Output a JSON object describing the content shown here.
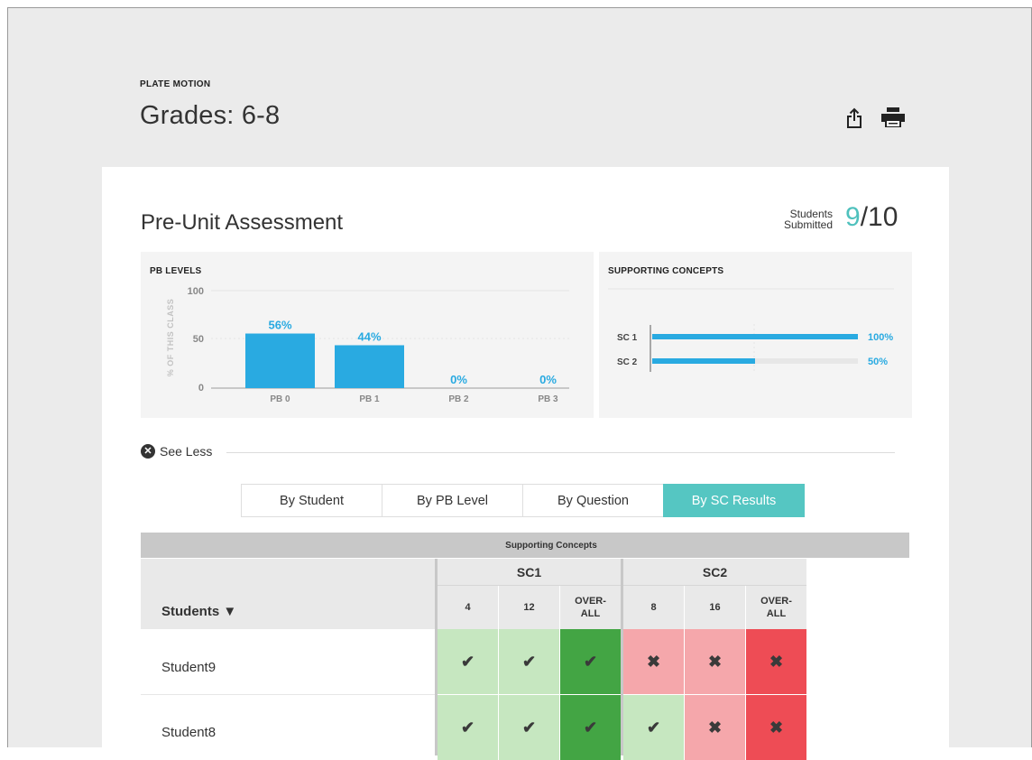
{
  "header": {
    "eyebrow": "PLATE MOTION",
    "title": "Grades: 6-8"
  },
  "icons": {
    "share": "share-icon",
    "print": "print-icon"
  },
  "assessment": {
    "title": "Pre-Unit Assessment",
    "submitted_label_line1": "Students",
    "submitted_label_line2": "Submitted",
    "submitted_value": "9",
    "submitted_total": "/10"
  },
  "pb_levels": {
    "title": "PB LEVELS",
    "ylabel": "% OF THIS CLASS",
    "yticks": [
      "100",
      "50",
      "0"
    ]
  },
  "supporting": {
    "title": "SUPPORTING CONCEPTS"
  },
  "chart_data": [
    {
      "type": "bar",
      "title": "PB LEVELS",
      "xlabel": "",
      "ylabel": "% OF THIS CLASS",
      "categories": [
        "PB 0",
        "PB 1",
        "PB 2",
        "PB 3"
      ],
      "values": [
        56,
        44,
        0,
        0
      ],
      "value_labels": [
        "56%",
        "44%",
        "0%",
        "0%"
      ],
      "ylim": [
        0,
        100
      ],
      "color": "#29aae1"
    },
    {
      "type": "bar",
      "orientation": "horizontal",
      "title": "SUPPORTING CONCEPTS",
      "categories": [
        "SC 1",
        "SC 2"
      ],
      "values": [
        100,
        50
      ],
      "value_labels": [
        "100%",
        "50%"
      ],
      "xlim": [
        0,
        100
      ],
      "color": "#29aae1"
    }
  ],
  "see_less": "See Less",
  "tabs": [
    {
      "label": "By Student",
      "active": false
    },
    {
      "label": "By PB Level",
      "active": false
    },
    {
      "label": "By Question",
      "active": false
    },
    {
      "label": "By SC Results",
      "active": true
    }
  ],
  "table": {
    "group_header": "Supporting Concepts",
    "students_header": "Students ▼",
    "groups": [
      {
        "label": "SC1",
        "columns": [
          "4",
          "12",
          "OVER-\nALL"
        ]
      },
      {
        "label": "SC2",
        "columns": [
          "8",
          "16",
          "OVER-\nALL"
        ]
      }
    ],
    "rows": [
      {
        "name": "Student9",
        "sc1": [
          "pass",
          "pass",
          "pass"
        ],
        "sc2": [
          "fail",
          "fail",
          "fail"
        ]
      },
      {
        "name": "Student8",
        "sc1": [
          "pass",
          "pass",
          "pass"
        ],
        "sc2": [
          "pass",
          "fail",
          "fail"
        ]
      }
    ],
    "symbols": {
      "pass": "✔",
      "fail": "✖"
    }
  },
  "colors": {
    "accent": "#55c6c2",
    "bar": "#29aae1",
    "pass_light": "#c6e7c0",
    "pass_overall": "#43a544",
    "fail_light": "#f5a7ab",
    "fail_overall": "#ee4c55"
  }
}
